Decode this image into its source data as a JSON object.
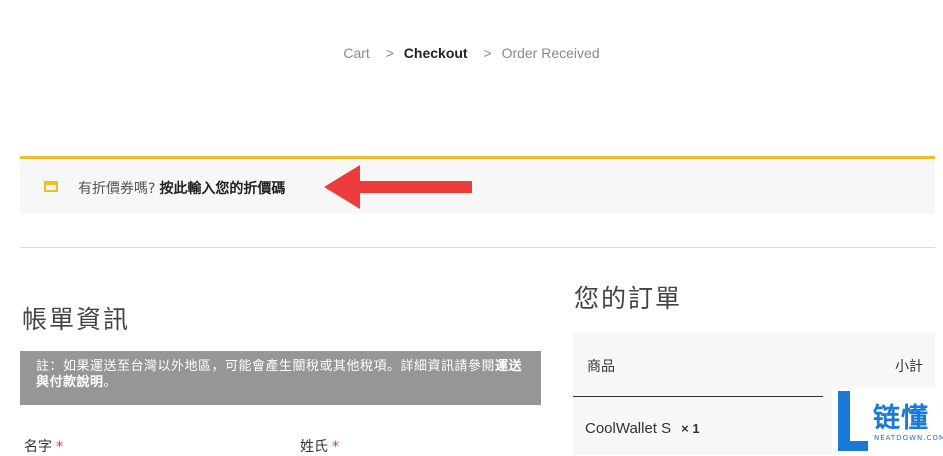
{
  "breadcrumb": {
    "steps": [
      "Cart",
      "Checkout",
      "Order Received"
    ],
    "separator": ">"
  },
  "coupon": {
    "question": "有折價券嗎?",
    "link": "按此輸入您的折價碼",
    "icon": "coupon-icon",
    "accent_color": "#f0bd2a"
  },
  "annotation": {
    "arrow_color": "#ee3b3b"
  },
  "billing": {
    "title": "帳單資訊",
    "notice_text": "註：如果運送至台灣以外地區，可能會產生關稅或其他稅項。詳細資訊請參閱",
    "notice_link": "運送與付款說明",
    "notice_end": "。",
    "first_name_label": "名字",
    "last_name_label": "姓氏",
    "required_mark": "*"
  },
  "order": {
    "title": "您的訂單",
    "col_product": "商品",
    "col_subtotal": "小計",
    "items": [
      {
        "name": "CoolWallet S",
        "qty": "× 1"
      }
    ]
  },
  "watermark": {
    "text": "链懂",
    "sub": "NEATDOWN.COM",
    "letter": "L"
  }
}
